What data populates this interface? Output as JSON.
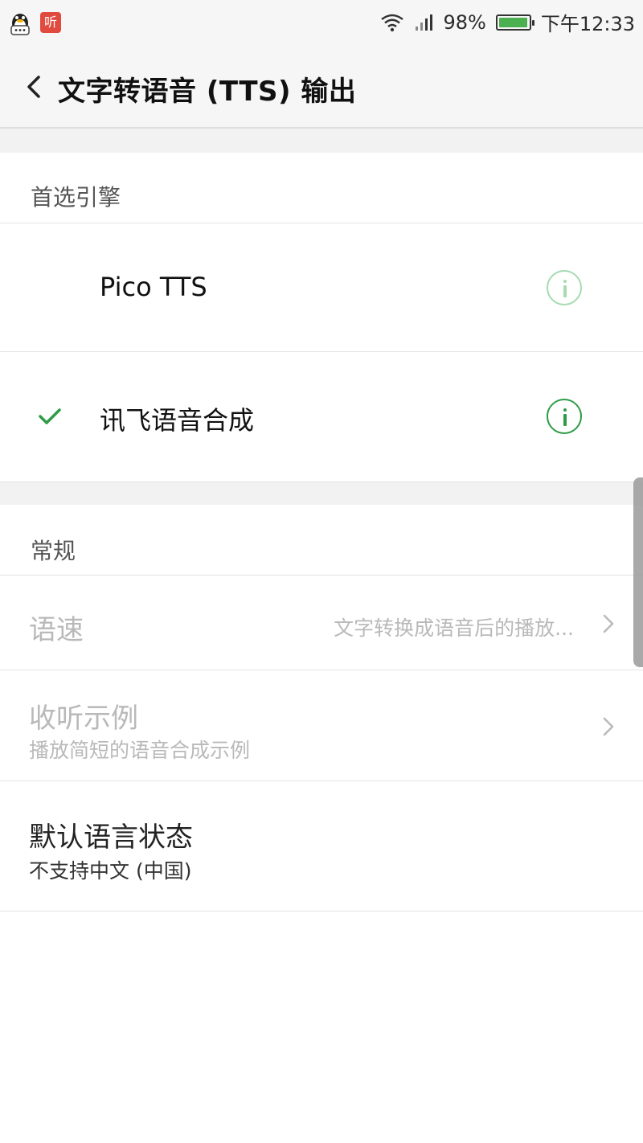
{
  "status_bar": {
    "battery_percent": "98%",
    "time": "下午12:33",
    "battery_level": 0.98,
    "notification_icons": [
      "qq-icon",
      "ting-app-icon"
    ],
    "ting_icon_glyph": "听"
  },
  "title_bar": {
    "title": "文字转语音 (TTS) 输出"
  },
  "preferred_engine": {
    "header": "首选引擎",
    "engines": [
      {
        "label": "Pico TTS",
        "selected": false
      },
      {
        "label": "讯飞语音合成",
        "selected": true
      }
    ]
  },
  "general": {
    "header": "常规",
    "speech_rate": {
      "title": "语速",
      "value": "文字转换成语音后的播放..."
    },
    "listen_example": {
      "title": "收听示例",
      "summary": "播放简短的语音合成示例"
    },
    "default_language_status": {
      "title": "默认语言状态",
      "summary": "不支持中文 (中国)"
    }
  },
  "colors": {
    "accent": "#2e9b46",
    "accent_light": "#a6dbb0",
    "disabled_text": "#b9b9b9"
  }
}
